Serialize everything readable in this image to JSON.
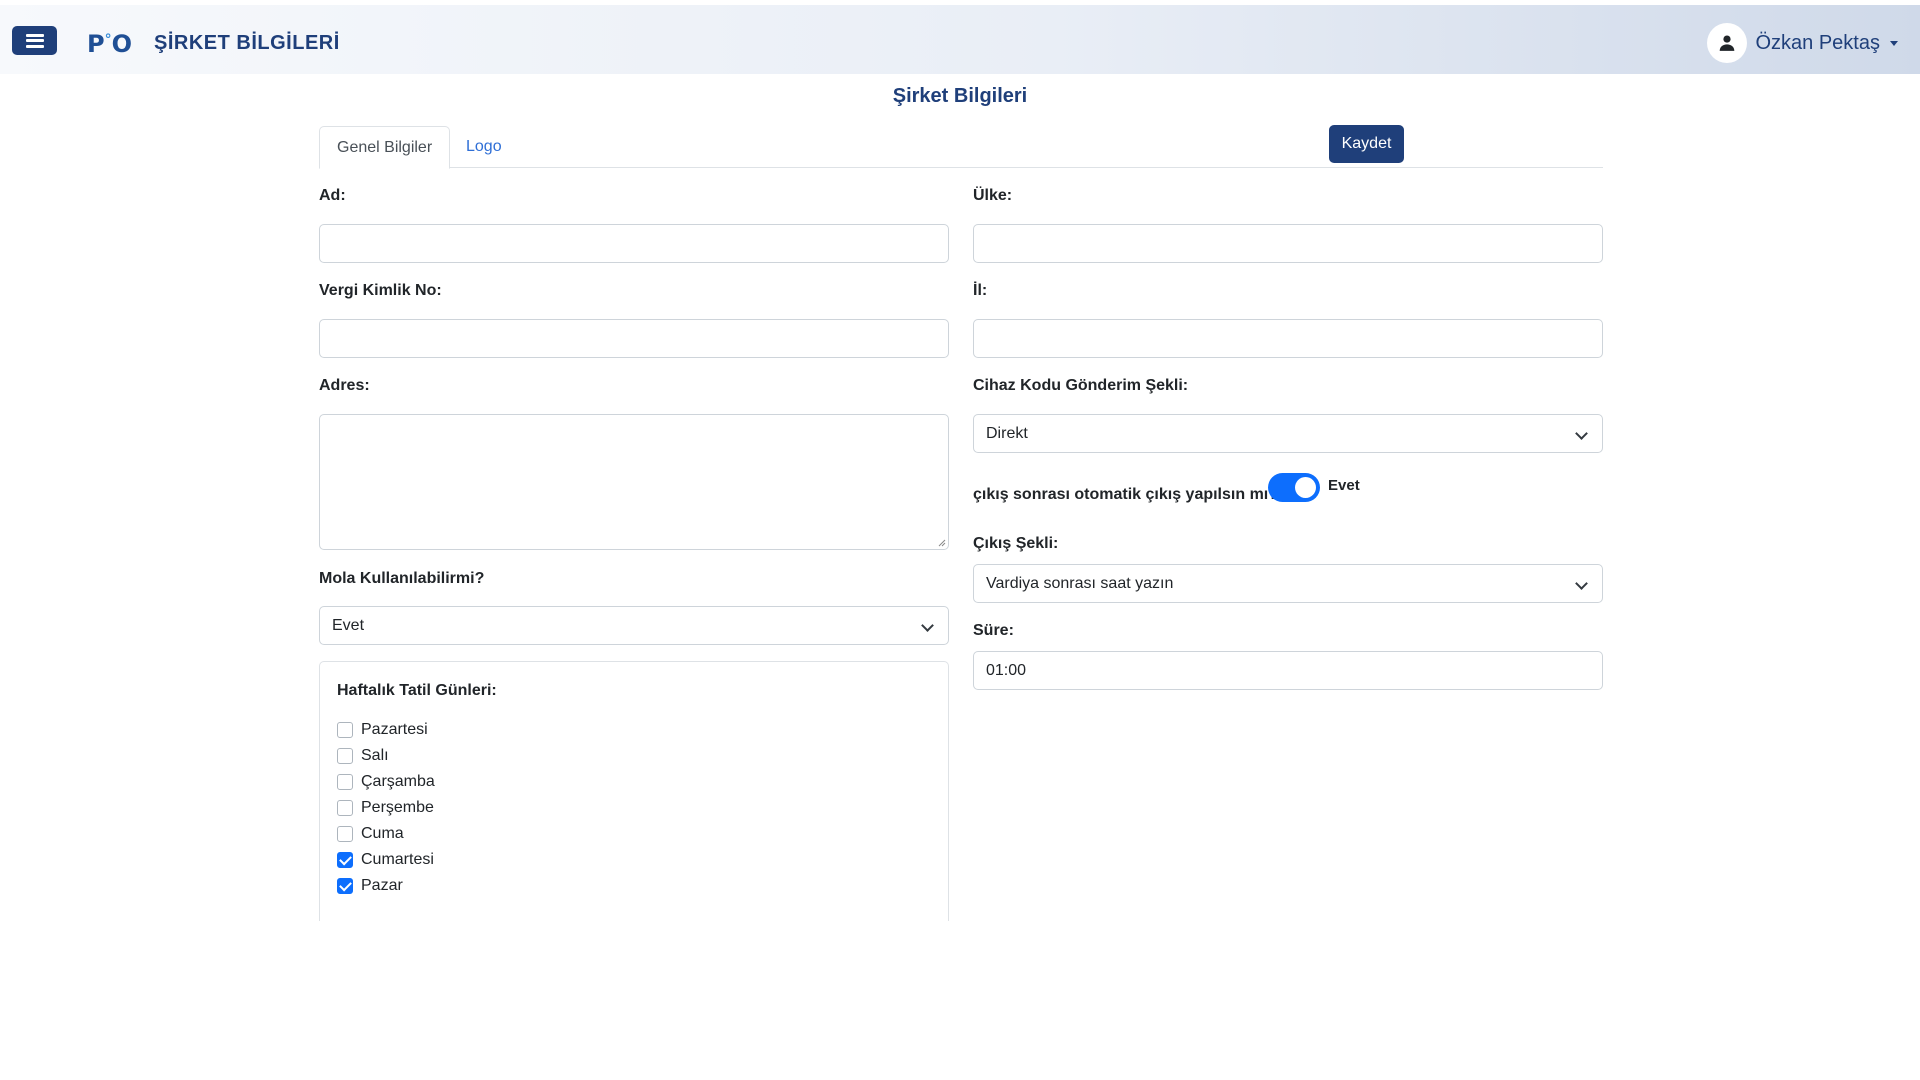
{
  "header": {
    "logo": {
      "left": "P",
      "dot": "°",
      "right": "O"
    },
    "title": "ŞİRKET BİLGİLERİ",
    "user_name": "Özkan Pektaş"
  },
  "page": {
    "title": "Şirket Bilgileri"
  },
  "tabs": [
    {
      "label": "Genel Bilgiler",
      "active": true
    },
    {
      "label": "Logo",
      "active": false
    }
  ],
  "save_label": "Kaydet",
  "form": {
    "ad": {
      "label": "Ad:",
      "value": ""
    },
    "vergi": {
      "label": "Vergi Kimlik No:",
      "value": ""
    },
    "adres": {
      "label": "Adres:",
      "value": ""
    },
    "mola": {
      "label": "Mola Kullanılabilirmi?",
      "value": "Evet"
    },
    "ulke": {
      "label": "Ülke:",
      "value": ""
    },
    "il": {
      "label": "İl:",
      "value": ""
    },
    "cihaz": {
      "label": "Cihaz Kodu Gönderim Şekli:",
      "value": "Direkt"
    },
    "otomatik": {
      "label": "çıkış sonrası otomatik çıkış yapılsın mı?",
      "value_label": "Evet",
      "checked": true
    },
    "cikis": {
      "label": "Çıkış Şekli:",
      "value": "Vardiya sonrası saat yazın"
    },
    "sure": {
      "label": "Süre:",
      "value": "01:00"
    }
  },
  "tatil": {
    "title": "Haftalık Tatil Günleri:",
    "days": [
      {
        "label": "Pazartesi",
        "checked": false
      },
      {
        "label": "Salı",
        "checked": false
      },
      {
        "label": "Çarşamba",
        "checked": false
      },
      {
        "label": "Perşembe",
        "checked": false
      },
      {
        "label": "Cuma",
        "checked": false
      },
      {
        "label": "Cumartesi",
        "checked": true
      },
      {
        "label": "Pazar",
        "checked": true
      }
    ]
  },
  "colors": {
    "primary": "#1f3f7a",
    "accent": "#0d6efd",
    "link": "#2f6fd6"
  }
}
